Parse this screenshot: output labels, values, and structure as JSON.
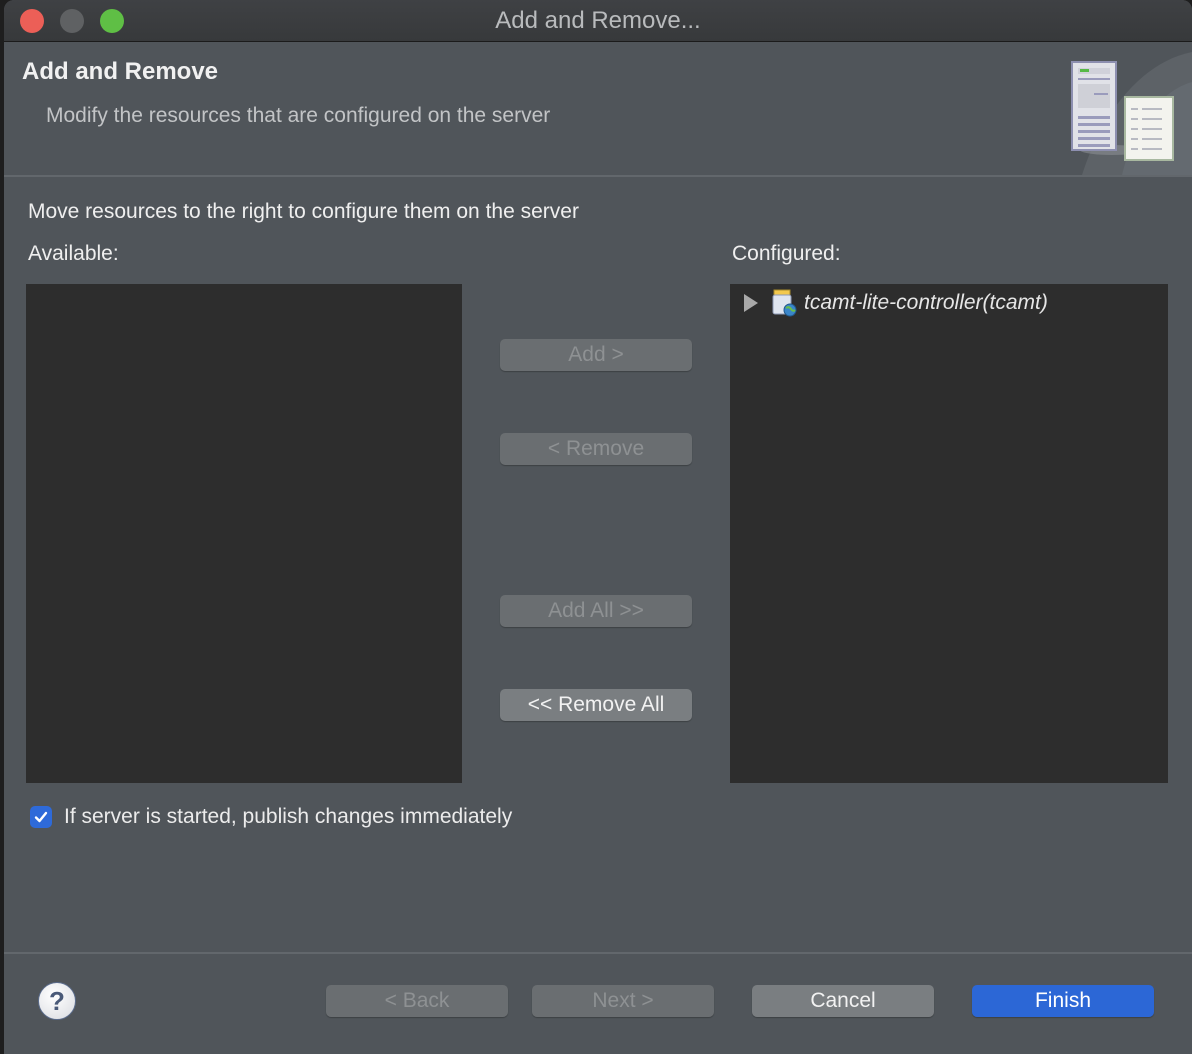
{
  "window": {
    "title": "Add and Remove...",
    "controls": [
      "close",
      "minimize",
      "maximize"
    ]
  },
  "header": {
    "title": "Add and Remove",
    "description": "Modify the resources that are configured on the server",
    "banner_icon": "server-document-icon"
  },
  "main": {
    "instructions": "Move resources to the right to configure them on the server",
    "available": {
      "label": "Available:",
      "items": []
    },
    "configured": {
      "label": "Configured:",
      "items": [
        {
          "label": "tcamt-lite-controller(tcamt)",
          "icon": "web-module-icon",
          "expanded": false
        }
      ]
    },
    "buttons": {
      "add": {
        "label": "Add >",
        "enabled": false
      },
      "remove": {
        "label": "< Remove",
        "enabled": false
      },
      "add_all": {
        "label": "Add All >>",
        "enabled": false
      },
      "remove_all": {
        "label": "<< Remove All",
        "enabled": true
      }
    },
    "publish_checkbox": {
      "label": "If server is started, publish changes immediately",
      "checked": true
    }
  },
  "footer": {
    "help_icon": "?",
    "back": {
      "label": "< Back",
      "enabled": false
    },
    "next": {
      "label": "Next >",
      "enabled": false
    },
    "cancel": {
      "label": "Cancel",
      "enabled": true
    },
    "finish": {
      "label": "Finish",
      "enabled": true
    }
  },
  "colors": {
    "accent": "#2c67d6",
    "dialog_bg": "#50555a",
    "list_bg": "#2d2d2d"
  }
}
